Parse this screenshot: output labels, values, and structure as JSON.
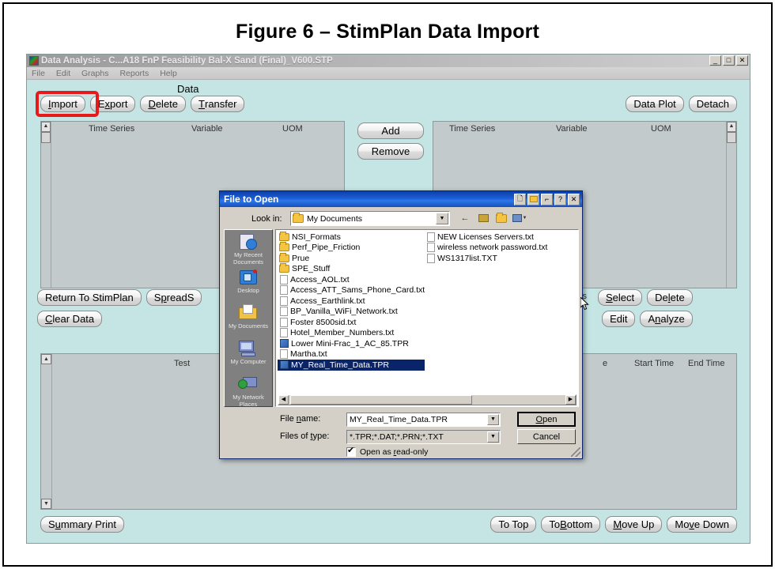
{
  "figure": {
    "caption": "Figure 6 – StimPlan Data Import"
  },
  "app": {
    "titlebar": {
      "title": "Data Analysis - C...A18 FnP Feasibility Bal-X Sand (Final)_V600.STP",
      "minimize": "_",
      "maximize": "□",
      "close": "✕"
    },
    "menu": [
      "File",
      "Edit",
      "Graphs",
      "Reports",
      "Help"
    ],
    "data_section_label": "Data",
    "data_buttons": [
      "Import",
      "Export",
      "Delete",
      "Transfer"
    ],
    "highlighted_button": "Import",
    "right_buttons": [
      "Data Plot",
      "Detach"
    ],
    "list_headers": [
      "Time Series",
      "Variable",
      "UOM"
    ],
    "transfer_buttons": [
      "Add",
      "Remove"
    ],
    "mid_left_buttons": [
      "Return To StimPlan",
      "SpreadS"
    ],
    "mid_left_buttons_row2": [
      "Clear Data"
    ],
    "mid_right_fragment": "ls",
    "mid_right_buttons": [
      "Select",
      "Delete"
    ],
    "mid_right_buttons_row2": [
      "Edit",
      "Analyze"
    ],
    "bottom_headers": [
      "Test",
      "e",
      "Start Time",
      "End Time"
    ],
    "bottom_left_buttons": [
      "Summary Print"
    ],
    "bottom_right_buttons": [
      "To Top",
      "To Bottom",
      "Move Up",
      "Move Down"
    ]
  },
  "dialog": {
    "title": "File to Open",
    "titlebar_buttons": [
      "new-folder",
      "up-folder",
      "view",
      "?",
      "✕"
    ],
    "lookin_label": "Look in:",
    "lookin_value": "My Documents",
    "nav_icons": [
      "back-arrow",
      "up-folder",
      "new-folder",
      "views-menu"
    ],
    "places": [
      {
        "label": "My Recent Documents",
        "icon": "recent-documents-icon"
      },
      {
        "label": "Desktop",
        "icon": "desktop-icon"
      },
      {
        "label": "My Documents",
        "icon": "my-documents-icon"
      },
      {
        "label": "My Computer",
        "icon": "my-computer-icon"
      },
      {
        "label": "My Network Places",
        "icon": "network-places-icon"
      }
    ],
    "files_col1": [
      {
        "name": "NSI_Formats",
        "type": "folder"
      },
      {
        "name": "Perf_Pipe_Friction",
        "type": "folder"
      },
      {
        "name": "Prue",
        "type": "folder"
      },
      {
        "name": "SPE_Stuff",
        "type": "folder"
      },
      {
        "name": "Access_AOL.txt",
        "type": "txt"
      },
      {
        "name": "Access_ATT_Sams_Phone_Card.txt",
        "type": "txt"
      },
      {
        "name": "Access_Earthlink.txt",
        "type": "txt"
      },
      {
        "name": "BP_Vanilla_WiFi_Network.txt",
        "type": "txt"
      },
      {
        "name": "Foster 8500sid.txt",
        "type": "txt"
      },
      {
        "name": "Hotel_Member_Numbers.txt",
        "type": "txt"
      },
      {
        "name": "Lower Mini-Frac_1_AC_85.TPR",
        "type": "tpr"
      },
      {
        "name": "Martha.txt",
        "type": "txt"
      },
      {
        "name": "MY_Real_Time_Data.TPR",
        "type": "tpr",
        "selected": true
      }
    ],
    "files_col2": [
      {
        "name": "NEW Licenses Servers.txt",
        "type": "txt"
      },
      {
        "name": "wireless network password.txt",
        "type": "txt"
      },
      {
        "name": "WS1317list.TXT",
        "type": "txt"
      }
    ],
    "filename_label": "File name:",
    "filename_value": "MY_Real_Time_Data.TPR",
    "filetype_label": "Files of type:",
    "filetype_value": "*.TPR;*.DAT;*.PRN;*.TXT",
    "open_button": "Open",
    "cancel_button": "Cancel",
    "readonly_label": "Open as read-only",
    "readonly_checked": true
  },
  "colors": {
    "app_background": "#c5e5e5",
    "list_background": "#c2cacb",
    "highlight_red": "#e8191b",
    "dialog_face": "#d4d0c8",
    "selection_blue": "#0a246a"
  }
}
